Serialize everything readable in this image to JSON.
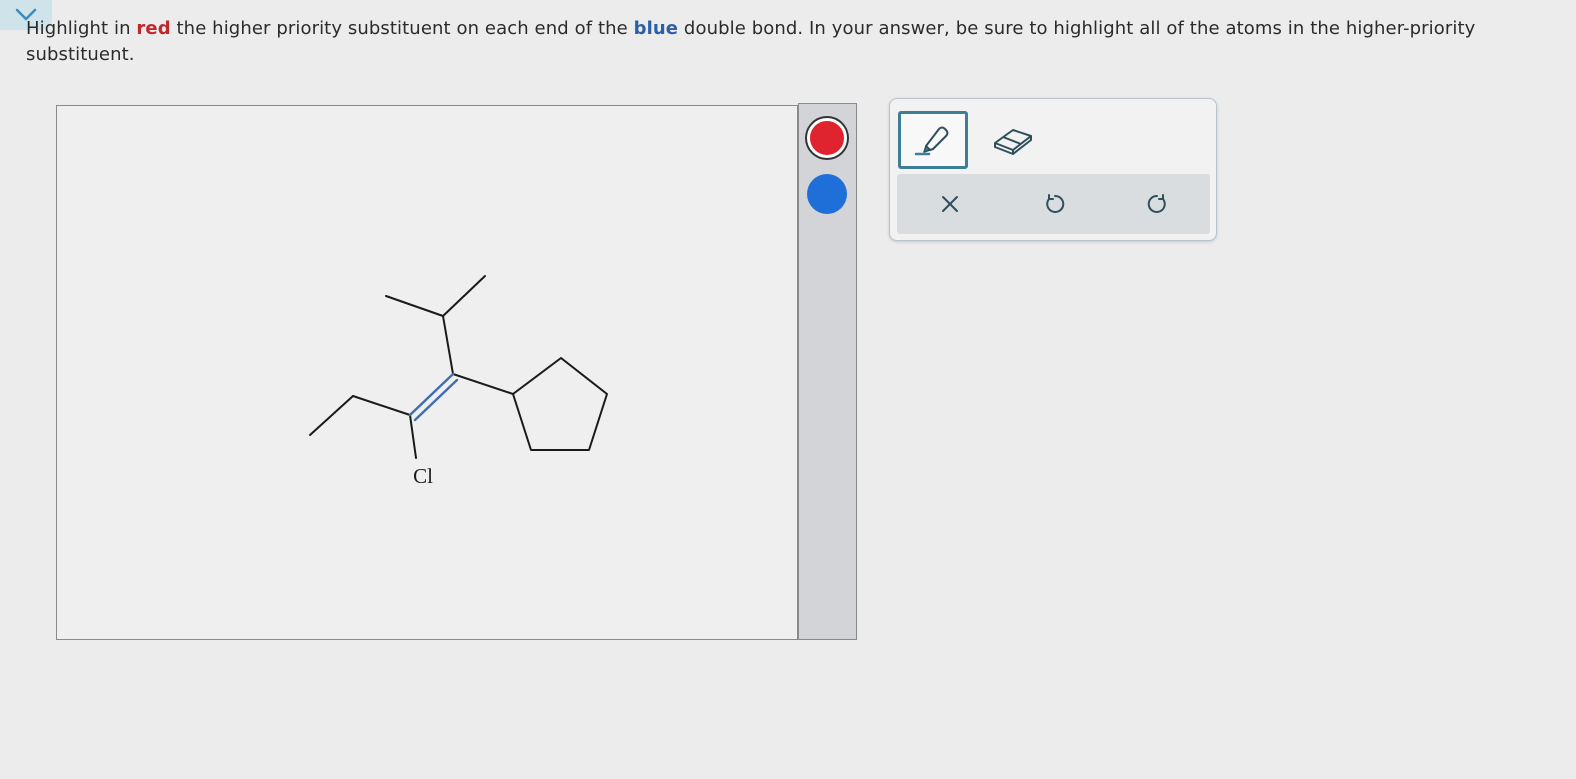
{
  "instructions": {
    "part1": "Highlight in ",
    "red_word": "red",
    "part2": " the higher priority substituent on each end of the ",
    "blue_word": "blue",
    "part3": " double bond. In your answer, be sure to highlight all of the atoms in the higher-priority substituent."
  },
  "molecule": {
    "atom_label": "Cl"
  },
  "palette": {
    "colors": [
      "#e0232e",
      "#1f6fd8"
    ],
    "selected": "red"
  },
  "toolbox": {
    "tools": [
      "highlighter-icon",
      "eraser-icon"
    ],
    "actions": [
      "clear-icon",
      "undo-icon",
      "redo-icon"
    ],
    "active_tool": "highlighter"
  },
  "colors": {
    "accent": "#3e7e96",
    "highlight_red": "#c0282d",
    "double_bond_blue": "#2b5fa8"
  }
}
